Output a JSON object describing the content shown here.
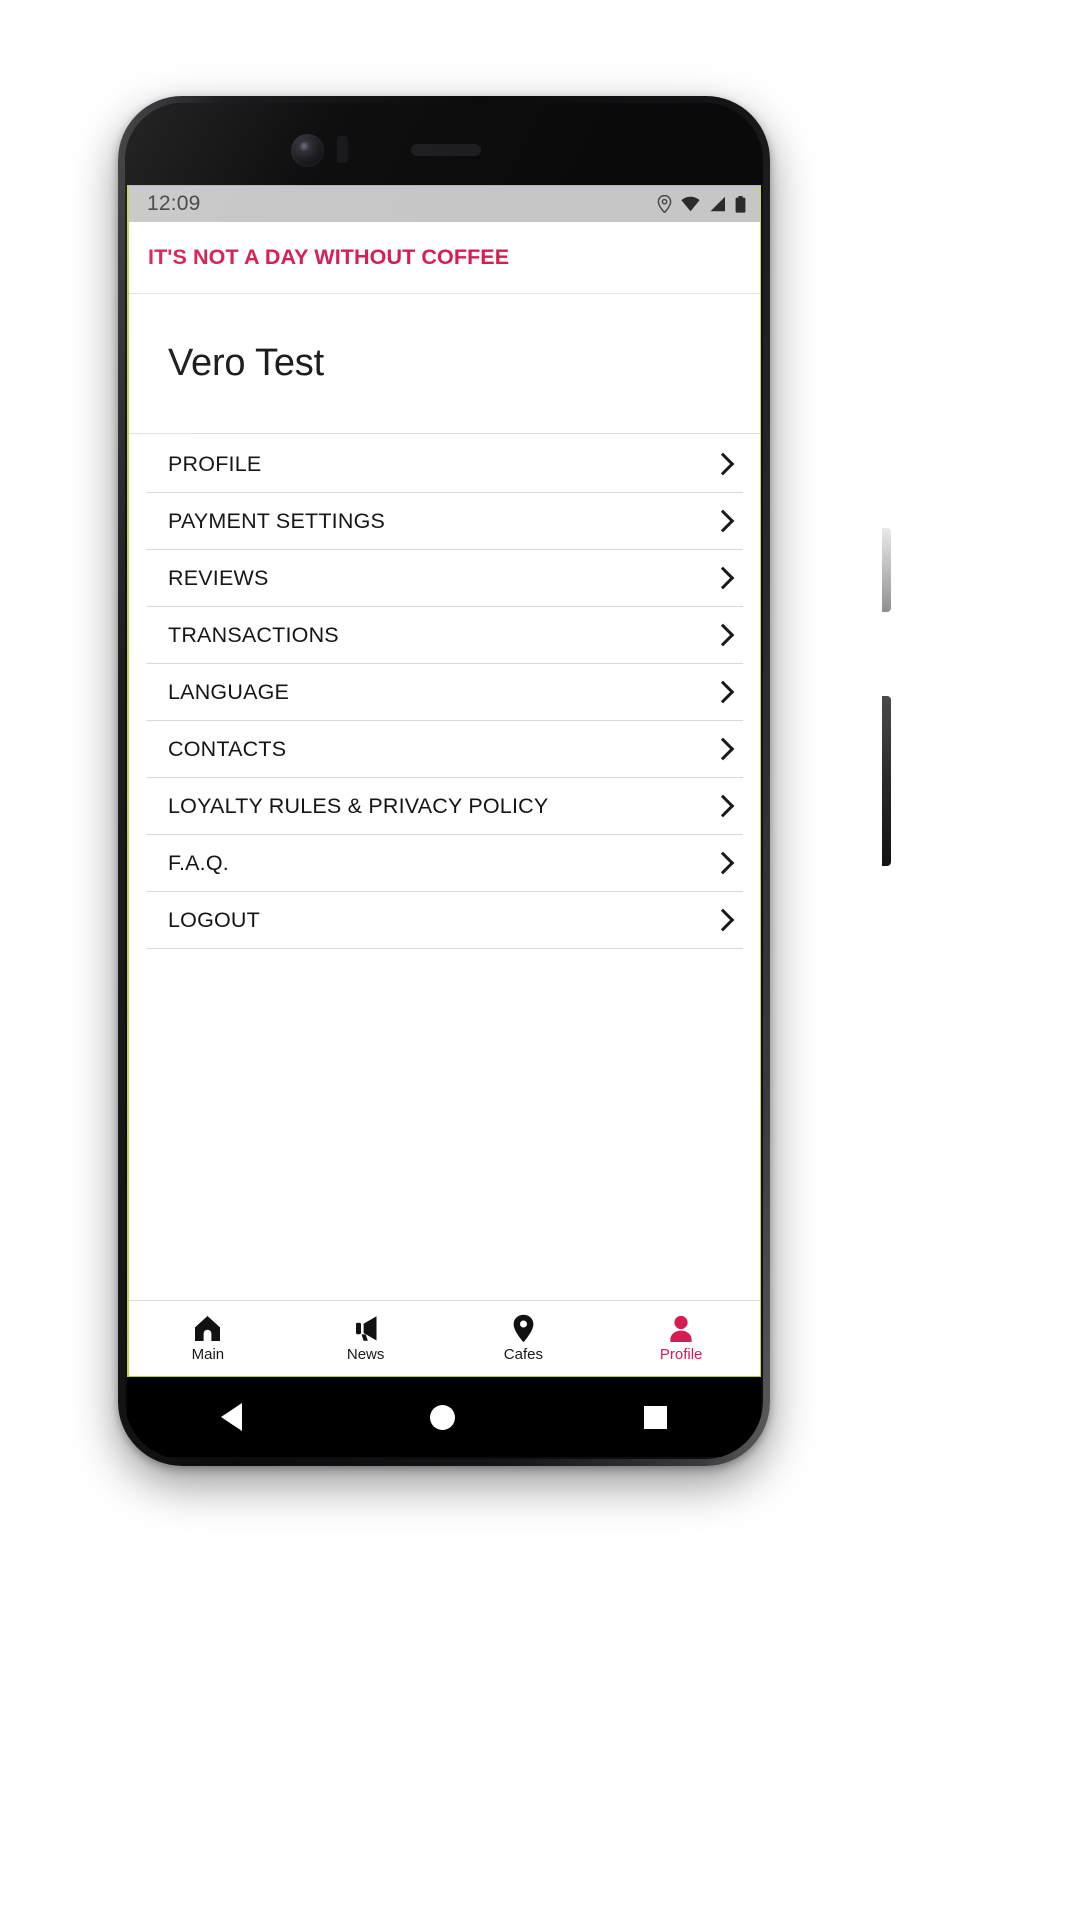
{
  "status_bar": {
    "time": "12:09",
    "icons": [
      {
        "name": "location-icon"
      },
      {
        "name": "wifi-icon"
      },
      {
        "name": "signal-icon"
      },
      {
        "name": "battery-icon"
      }
    ]
  },
  "app_header": {
    "title": "IT'S NOT A DAY WITHOUT COFFEE",
    "accent_color": "#d81b52"
  },
  "user": {
    "name": "Vero Test"
  },
  "menu": {
    "items": [
      {
        "label": "PROFILE",
        "chevron": "chevron-right-icon"
      },
      {
        "label": "PAYMENT SETTINGS",
        "chevron": "chevron-right-icon"
      },
      {
        "label": "REVIEWS",
        "chevron": "chevron-right-icon"
      },
      {
        "label": "TRANSACTIONS",
        "chevron": "chevron-right-icon"
      },
      {
        "label": "LANGUAGE",
        "chevron": "chevron-right-icon"
      },
      {
        "label": "CONTACTS",
        "chevron": "chevron-right-icon"
      },
      {
        "label": "LOYALTY RULES & PRIVACY POLICY",
        "chevron": "chevron-right-icon"
      },
      {
        "label": "F.A.Q.",
        "chevron": "chevron-right-icon"
      },
      {
        "label": "LOGOUT",
        "chevron": "chevron-right-icon"
      }
    ]
  },
  "tab_bar": {
    "active_color": "#d81b52",
    "inactive_color": "#1a1a1a",
    "tabs": [
      {
        "label": "Main",
        "icon": "home-icon",
        "active": false
      },
      {
        "label": "News",
        "icon": "megaphone-icon",
        "active": false
      },
      {
        "label": "Cafes",
        "icon": "map-pin-icon",
        "active": false
      },
      {
        "label": "Profile",
        "icon": "person-icon",
        "active": true
      }
    ]
  },
  "android_nav": {
    "buttons": [
      {
        "name": "back-button"
      },
      {
        "name": "home-button"
      },
      {
        "name": "recents-button"
      }
    ]
  }
}
